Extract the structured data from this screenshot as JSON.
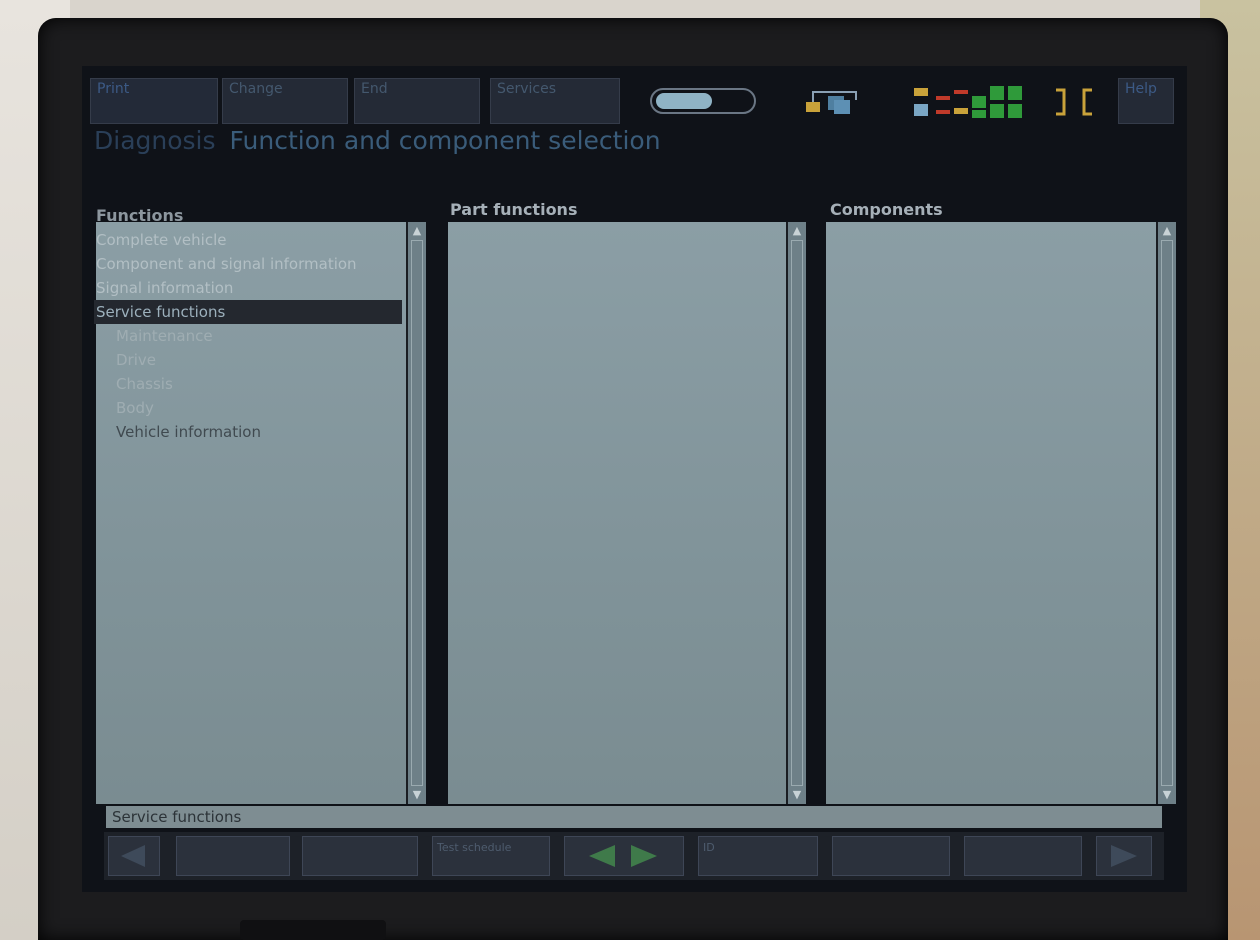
{
  "toolbar": {
    "buttons": [
      {
        "label": "Print"
      },
      {
        "label": "Change"
      },
      {
        "label": "End"
      },
      {
        "label": "Services"
      }
    ],
    "help_label": "Help"
  },
  "header": {
    "section": "Diagnosis",
    "title": "Function and component selection"
  },
  "columns": {
    "functions": "Functions",
    "part_functions": "Part functions",
    "components": "Components"
  },
  "functions_list": [
    {
      "label": "Complete vehicle"
    },
    {
      "label": "Component and signal information"
    },
    {
      "label": "Signal information"
    },
    {
      "label": "Service functions"
    },
    {
      "label": "Maintenance"
    },
    {
      "label": "Drive"
    },
    {
      "label": "Chassis"
    },
    {
      "label": "Body"
    },
    {
      "label": "Vehicle information"
    }
  ],
  "status_text": "Service functions",
  "bottom_buttons": [
    {
      "label": ""
    },
    {
      "label": ""
    },
    {
      "label": "Test schedule"
    },
    {
      "label": "ID"
    },
    {
      "label": ""
    },
    {
      "label": ""
    }
  ],
  "colors": {
    "panel": "#86999f",
    "screen": "#0f1218",
    "title": "#3a5c7a",
    "selection": "#24282f"
  },
  "icons": [
    "toggle-switch-icon",
    "network-icon",
    "status-indicator-icon",
    "bracket-icon",
    "arrow-left-icon",
    "arrow-right-icon",
    "scroll-up-icon",
    "scroll-down-icon"
  ]
}
